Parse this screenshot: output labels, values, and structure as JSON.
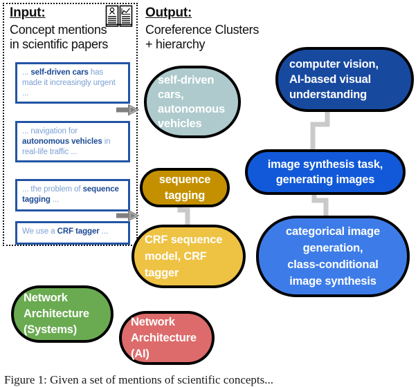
{
  "figure": {
    "caption": "Figure 1: Given a set of mentions of scientific concepts..."
  },
  "input_panel": {
    "heading": "Input:",
    "subtitle": "Concept mentions\nin scientific papers",
    "icon": "book-chart-icon",
    "mentions": [
      {
        "id": "mention-self-driven-cars",
        "prefix": "... ",
        "bold": "self-driven cars",
        "suffix": " has made it increasingly urgent ..."
      },
      {
        "id": "mention-autonomous-vehicles",
        "prefix": "... navigation for ",
        "bold": "autonomous vehicles",
        "suffix": " in real-life traffic ..."
      },
      {
        "id": "mention-sequence-tagging",
        "prefix": "... the problem of ",
        "bold": "sequence tagging",
        "suffix": " ..."
      },
      {
        "id": "mention-crf-tagger",
        "prefix": "We use a ",
        "bold": "CRF tagger",
        "suffix": " ..."
      }
    ]
  },
  "output_panel": {
    "heading": "Output:",
    "subtitle": "Coreference Clusters\n+ hierarchy"
  },
  "clusters": [
    {
      "id": "cluster-self-driven-cars",
      "label": "self-driven\ncars,\nautonomous\nvehicles",
      "color": "#aecacd"
    },
    {
      "id": "cluster-computer-vision",
      "label": "computer vision,\nAI-based visual\nunderstanding",
      "color": "#17499f"
    },
    {
      "id": "cluster-image-synthesis",
      "label": "image synthesis task,\ngenerating images",
      "color": "#1159d9"
    },
    {
      "id": "cluster-categorical-image-generation",
      "label": "categorical image\ngeneration,\nclass-conditional\nimage synthesis",
      "color": "#3d7ce8"
    },
    {
      "id": "cluster-sequence-tagging",
      "label": "sequence\ntagging",
      "color": "#c49000"
    },
    {
      "id": "cluster-crf-sequence-model",
      "label": "CRF sequence\nmodel, CRF\ntagger",
      "color": "#eec243"
    },
    {
      "id": "cluster-network-architecture-systems",
      "label": "Network\nArchitecture\n(Systems)",
      "color": "#6aab51"
    },
    {
      "id": "cluster-network-architecture-ai",
      "label": "Network\nArchitecture\n(AI)",
      "color": "#dd6b6b"
    }
  ],
  "edges": [
    {
      "id": "edge-computer-vision-to-image-synthesis",
      "from": "cluster-computer-vision",
      "to": "cluster-image-synthesis"
    },
    {
      "id": "edge-image-synthesis-to-categorical",
      "from": "cluster-image-synthesis",
      "to": "cluster-categorical-image-generation"
    },
    {
      "id": "edge-sequence-tagging-to-crf",
      "from": "cluster-sequence-tagging",
      "to": "cluster-crf-sequence-model"
    }
  ],
  "arrows": [
    {
      "id": "arrow-mentions-to-vehicles-cluster"
    },
    {
      "id": "arrow-mentions-to-crf-cluster"
    }
  ],
  "colors": {
    "mention_border": "#2254a4",
    "mention_text": "#7a9fd4",
    "mention_bold": "#1c4a94",
    "arrow": "#808080",
    "connector": "#c9c9c9",
    "node_outline": "#000000"
  }
}
